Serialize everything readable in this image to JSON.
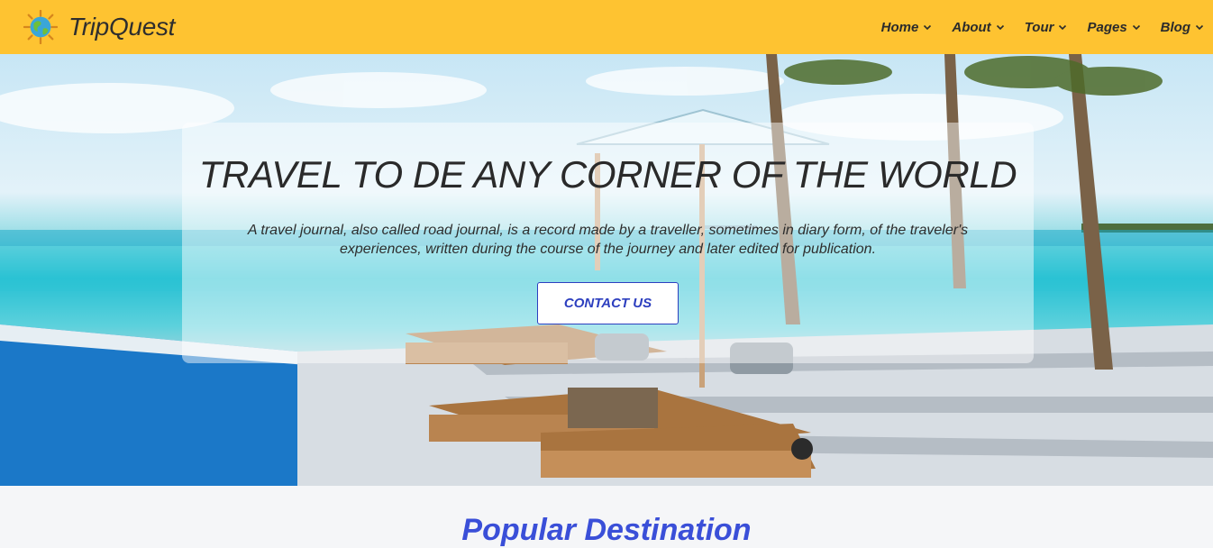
{
  "header": {
    "brand_name": "TripQuest",
    "logo_icon": "globe-icon",
    "nav": [
      {
        "label": "Home"
      },
      {
        "label": "About"
      },
      {
        "label": "Tour"
      },
      {
        "label": "Pages"
      },
      {
        "label": "Blog"
      }
    ],
    "background_color": "#fec331"
  },
  "hero": {
    "title": "TRAVEL TO DE ANY CORNER OF THE WORLD",
    "description": "A travel journal, also called road journal, is a record made by a traveller, sometimes in diary form, of the traveler's experiences, written during the course of the journey and later edited for publication.",
    "cta_label": "CONTACT US",
    "image": "beach-resort-photo",
    "accent_color": "#2d3fbf"
  },
  "section": {
    "title": "Popular Destination",
    "title_color": "#3a4fd8"
  }
}
